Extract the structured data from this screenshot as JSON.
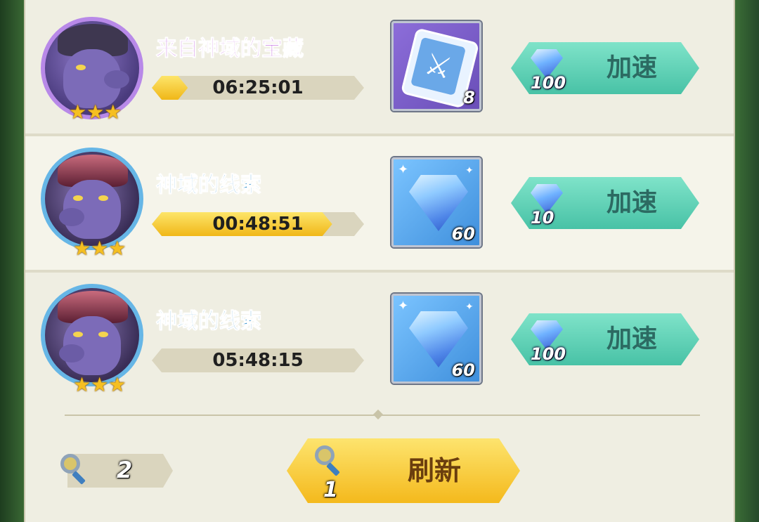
{
  "quests": [
    {
      "title": "来自神域的宝藏",
      "title_color": "#b23cd6",
      "stars": "★★★",
      "timer": "06:25:01",
      "progress": 0.17,
      "reward": {
        "icon": "scroll-icon",
        "count": "8"
      },
      "speed_up": {
        "label": "加速",
        "cost": "100",
        "icon": "diamond-icon"
      }
    },
    {
      "title": "神域的线索",
      "title_color": "#2f8fcc",
      "stars": "★★★",
      "timer": "00:48:51",
      "progress": 0.85,
      "reward": {
        "icon": "diamond-icon",
        "count": "60"
      },
      "speed_up": {
        "label": "加速",
        "cost": "10",
        "icon": "diamond-icon"
      }
    },
    {
      "title": "神域的线索",
      "title_color": "#2f8fcc",
      "stars": "★★★",
      "timer": "05:48:15",
      "progress": 0.0,
      "reward": {
        "icon": "diamond-icon",
        "count": "60"
      },
      "speed_up": {
        "label": "加速",
        "cost": "100",
        "icon": "diamond-icon"
      }
    }
  ],
  "footer": {
    "search_count": "2",
    "refresh_label": "刷新",
    "refresh_cost": "1"
  },
  "colors": {
    "speed_button": "#48c2a6",
    "refresh_button": "#f4b91c",
    "timer_fill": "#f0b718"
  }
}
